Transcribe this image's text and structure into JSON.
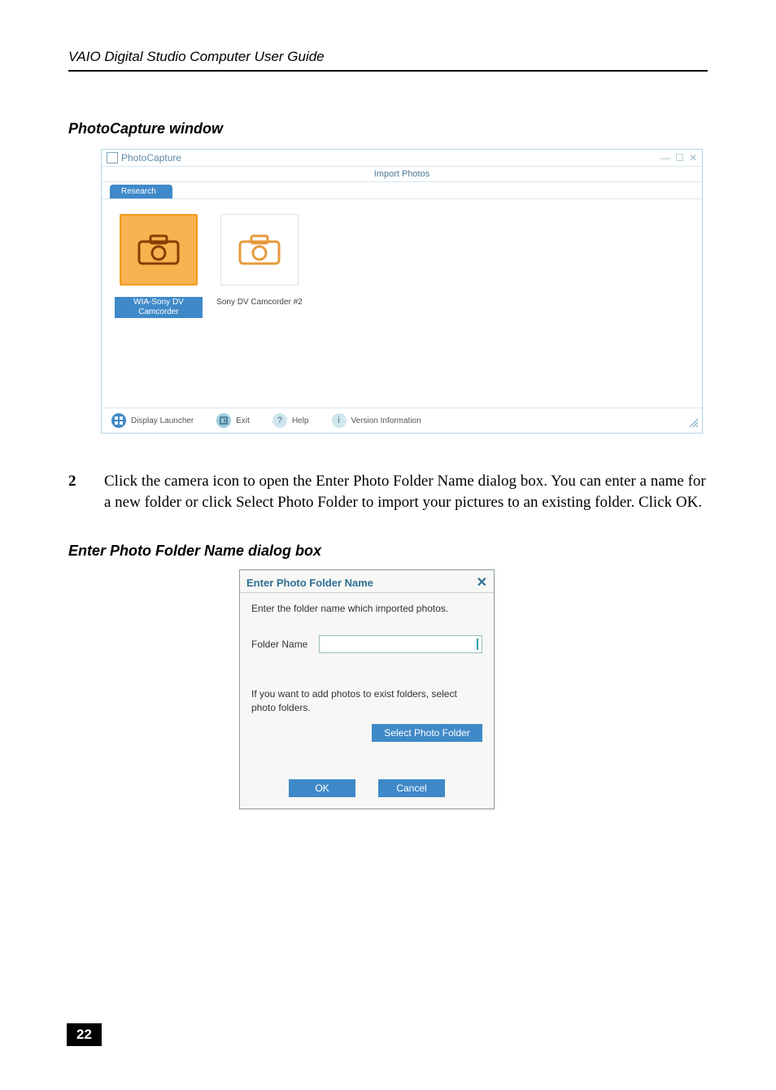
{
  "header_line": "VAIO Digital Studio Computer User Guide",
  "caption1": "PhotoCapture window",
  "photocapture": {
    "app_title": "PhotoCapture",
    "section_title": "Import Photos",
    "tab_label": "Research",
    "devices": [
      {
        "label": "WIA-Sony DV Camcorder",
        "selected": true
      },
      {
        "label": "Sony DV Camcorder #2",
        "selected": false
      }
    ],
    "status": {
      "launcher": "Display Launcher",
      "exit": "Exit",
      "help": "Help",
      "version": "Version Information"
    },
    "winctrl": {
      "min": "—",
      "max": "☐",
      "close": "✕"
    }
  },
  "step": {
    "num": "2",
    "text": "Click the camera icon to open the Enter Photo Folder Name dialog box. You can enter a name for a new folder or click Select Photo Folder to import your pictures to an existing folder. Click OK."
  },
  "caption2": "Enter Photo Folder Name dialog box",
  "dialog": {
    "title": "Enter Photo Folder Name",
    "line1": "Enter the folder name which imported photos.",
    "folder_label": "Folder Name",
    "folder_value": "",
    "line2": "If you want to add photos to exist folders, select photo folders.",
    "select_btn": "Select Photo Folder",
    "ok": "OK",
    "cancel": "Cancel"
  },
  "page_number": "22"
}
